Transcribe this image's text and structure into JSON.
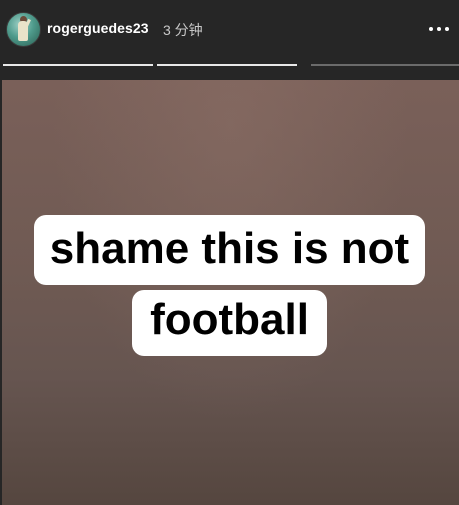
{
  "header": {
    "username": "rogerguedes23",
    "time": "3 分钟",
    "avatar_icon": "profile-avatar"
  },
  "story": {
    "progress_segments": 3,
    "current_segment": 2,
    "caption_lines": [
      "shame this is not",
      "football"
    ],
    "background_colors": [
      "#7a6059",
      "#55463f"
    ],
    "caption_bg": "#ffffff",
    "caption_text_color": "#000000"
  },
  "menu": {
    "icon": "more-horizontal-icon"
  }
}
